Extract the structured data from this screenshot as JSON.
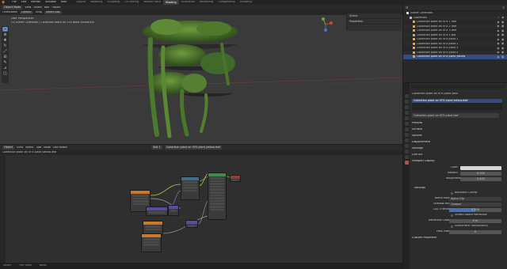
{
  "topbar": {
    "menus": [
      "File",
      "Edit",
      "Render",
      "Window",
      "Help"
    ],
    "workspaces": [
      "Layout",
      "Modeling",
      "Sculpting",
      "UV Editing",
      "Texture Paint",
      "Shading",
      "Animation",
      "Rendering",
      "Compositing",
      "Scripting"
    ],
    "active_workspace": "Shading"
  },
  "viewport": {
    "header_items": [
      "Object Mode",
      "View",
      "Select",
      "Add",
      "Object"
    ],
    "header2_items": [
      "Orientation",
      "Default",
      "Drag",
      "Select Box"
    ],
    "overlay_line1": "User Perspective",
    "overlay_line2": "(1) Scene Collection | Collection plant on VFX plant yellow.xyz",
    "scene_panel": [
      "Scene",
      "Properties"
    ]
  },
  "node_editor": {
    "header_items": [
      "Object",
      "View",
      "Select",
      "Add",
      "Node",
      "Use Nodes"
    ],
    "slot": "Slot 1",
    "material": "Collection plant on VFX plant yellow.leaf",
    "breadcrumb": "Collection plant on VFX plant yellow.leaf",
    "status": [
      "Select",
      "Pan View",
      "Node"
    ]
  },
  "outliner": {
    "title": "Scene Collection",
    "items": [
      "Collection",
      "Collection plant on VFX 1 leaf",
      "Collection plant on VFX 2 leaf",
      "Collection plant on VFX 3 leaf",
      "Collection plant on VFX 4 pot",
      "Collection plant on VFX plant 1",
      "Collection plant on VFX plant 2",
      "Collection plant on VFX plant 3",
      "Collection plant on VFX plant 4",
      "Collection plant on VFX plant yellow"
    ]
  },
  "properties": {
    "object_name": "Collection plant on VFX plant yello",
    "slot_label": "Collection plant on VFX plant yellow.leaf",
    "material_name": "Collection plant on VFX plant leaf",
    "sections": [
      "Preview",
      "Surface",
      "Volume",
      "Displacement",
      "Settings",
      "Line Art",
      "Viewport Display"
    ],
    "vp_color_label": "Color",
    "metallic_label": "Metallic",
    "metallic_value": "0.000",
    "roughness_label": "Roughness",
    "roughness_value": "0.400",
    "settings_title": "Settings",
    "backface_label": "Backface Culling",
    "blend_label": "Blend Mode",
    "blend_value": "Alpha Clip",
    "shadow_label": "Shadow Mode",
    "shadow_value": "Opaque",
    "clip_label": "Clip Threshold",
    "clip_value": "0.500",
    "screen_refr_label": "Screen Space Refraction",
    "refr_depth_label": "Refraction Depth",
    "refr_depth_value": "0 m",
    "sss_label": "Subsurface Translucency",
    "pass_label": "Pass Index",
    "pass_value": "0",
    "custom_props": "Custom Properties"
  },
  "colors": {
    "accent": "#4772b3",
    "selected_row": "#334d80",
    "node_shader": "#3e8a4f",
    "node_texture": "#c9782c",
    "node_vector": "#5c4ba0"
  }
}
